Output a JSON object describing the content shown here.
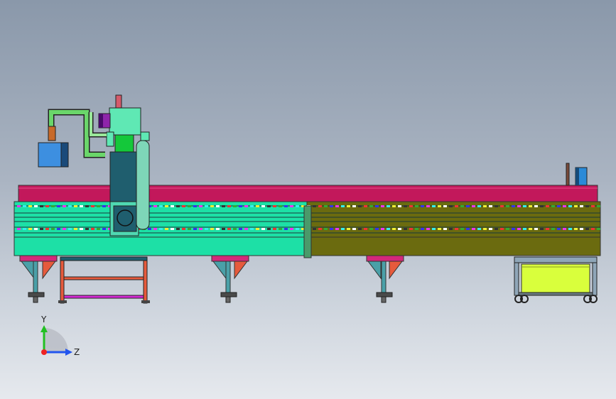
{
  "triad": {
    "y_label": "Y",
    "z_label": "Z",
    "y_color": "#22c022",
    "z_color": "#2255ee",
    "origin_color": "#ee2222"
  },
  "colors": {
    "background_top": "#8a98aa",
    "background_bottom": "#e6e9ee",
    "bed_top": "#c2185b",
    "frame_left": "#1de0a6",
    "frame_right": "#6b6b0f",
    "gantry": "#1f5e6e",
    "spindle_head": "#5fe8b4",
    "motor": "#8e24aa",
    "dust_box": "#3d8fe0",
    "cart": "#d9ff3c",
    "leg": "#4aa0a8",
    "brace": "#e65a3c"
  },
  "icons": [
    "axis-triad-icon"
  ]
}
